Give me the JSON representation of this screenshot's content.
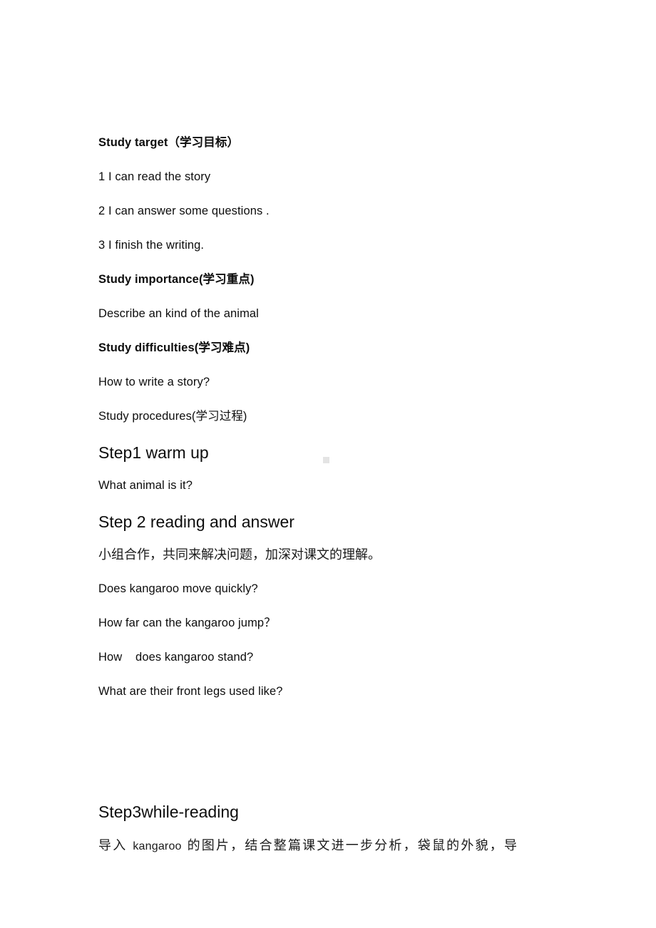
{
  "document": {
    "blocks": [
      {
        "id": "study-target-heading",
        "text": "Study target（学习目标）"
      },
      {
        "id": "target-item-1",
        "text": "1 I can read the story"
      },
      {
        "id": "target-item-2",
        "text": "2 I can answer some questions ."
      },
      {
        "id": "target-item-3",
        "text": "3 I finish the writing."
      },
      {
        "id": "study-importance-heading",
        "text": "Study importance(学习重点)"
      },
      {
        "id": "study-importance-body",
        "text": "Describe an kind of the animal"
      },
      {
        "id": "study-difficulties-heading",
        "text": "Study difficulties(学习难点)"
      },
      {
        "id": "study-difficulties-body",
        "text": "How to write a story?"
      },
      {
        "id": "study-procedures-heading",
        "text": "Study procedures(学习过程)"
      },
      {
        "id": "step1-heading",
        "text": "Step1 warm up"
      },
      {
        "id": "step1-body",
        "text": "What animal is it?"
      },
      {
        "id": "step2-heading",
        "text": "Step 2 reading and answer"
      },
      {
        "id": "step2-instruction",
        "text": "小组合作，共同来解决问题，加深对课文的理解。"
      },
      {
        "id": "question-1",
        "text": "Does kangaroo move quickly?"
      },
      {
        "id": "question-2",
        "text": "How far can the kangaroo jump？"
      },
      {
        "id": "question-3",
        "text": "How    does kangaroo stand?"
      },
      {
        "id": "question-4",
        "text": "What are their front legs used like?"
      },
      {
        "id": "step3-heading",
        "text": "Step3while-reading"
      }
    ],
    "final_line": {
      "prefix": "导入 ",
      "latin": "kangaroo",
      "suffix": " 的图片，结合整篇课文进一步分析，袋鼠的外貌，导"
    }
  }
}
